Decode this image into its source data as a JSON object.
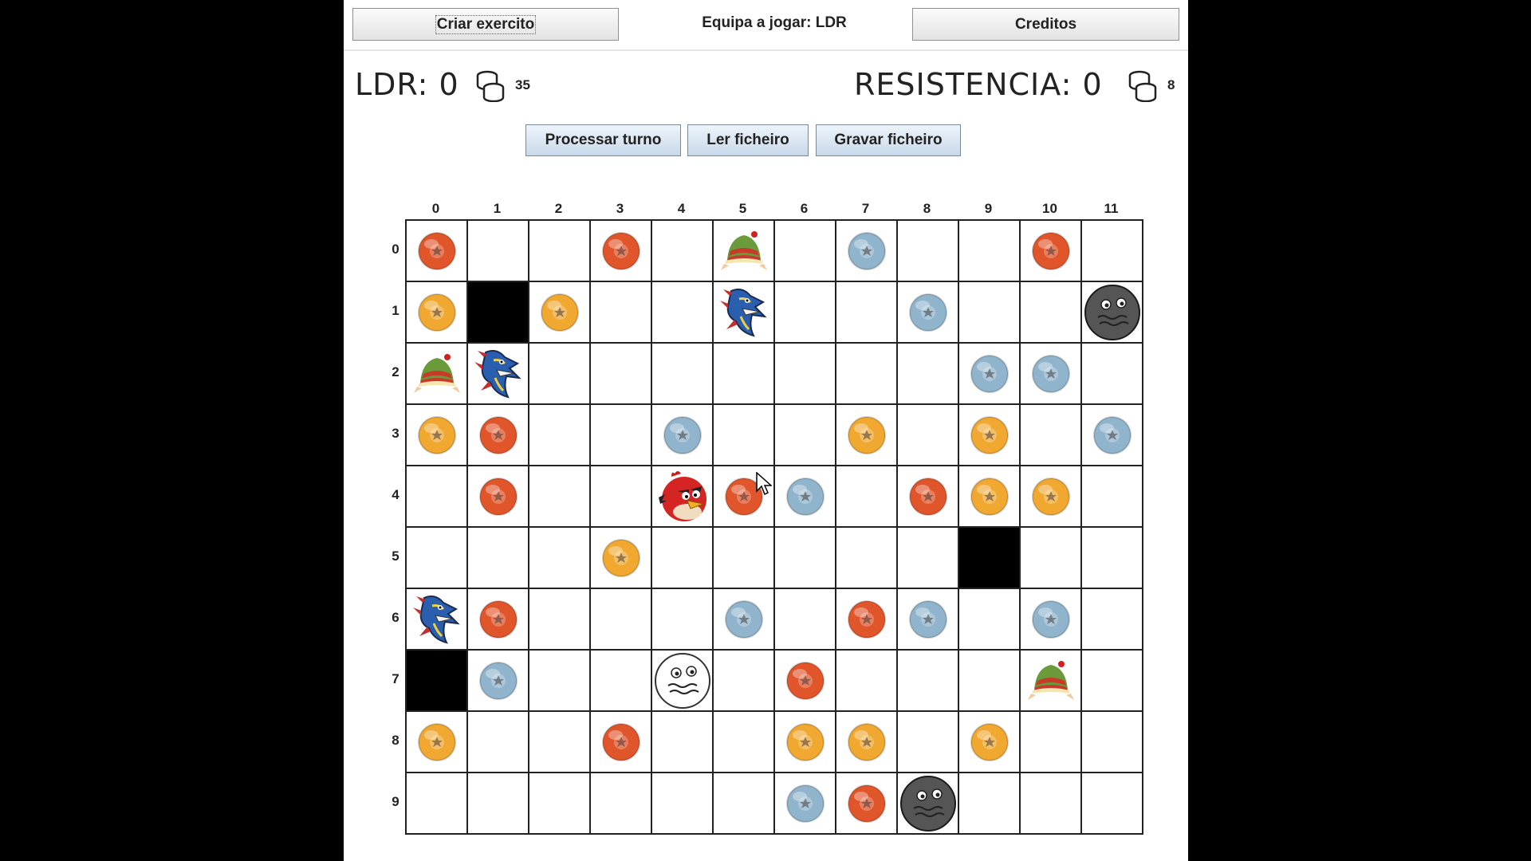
{
  "toolbar": {
    "create_army_label": "Criar exercito",
    "team_playing_label": "Equipa a jogar:  LDR",
    "credits_label": "Creditos"
  },
  "scores": {
    "left_text": "LDR: 0",
    "left_coins": "35",
    "right_text": "RESISTENCIA: 0",
    "right_coins": "8"
  },
  "actions": {
    "process_turn_label": "Processar turno",
    "read_file_label": "Ler ficheiro",
    "save_file_label": "Gravar ficheiro"
  },
  "board": {
    "columns": [
      "0",
      "1",
      "2",
      "3",
      "4",
      "5",
      "6",
      "7",
      "8",
      "9",
      "10",
      "11"
    ],
    "rows": [
      "0",
      "1",
      "2",
      "3",
      "4",
      "5",
      "6",
      "7",
      "8",
      "9"
    ],
    "colors": {
      "orange_coin": "#e0552a",
      "gold_coin": "#f0a830",
      "blue_coin": "#8fb4cc",
      "wall": "#000000"
    },
    "cells": [
      [
        "orange",
        "",
        "",
        "orange",
        "",
        "elf",
        "",
        "blue",
        "",
        "",
        "orange",
        ""
      ],
      [
        "gold",
        "wall",
        "gold",
        "",
        "",
        "dragon",
        "",
        "",
        "blue",
        "",
        "",
        "dark-ghost"
      ],
      [
        "elf",
        "dragon",
        "",
        "",
        "",
        "",
        "",
        "",
        "",
        "blue",
        "blue",
        ""
      ],
      [
        "gold",
        "orange",
        "",
        "",
        "blue",
        "",
        "",
        "gold",
        "",
        "gold",
        "",
        "blue"
      ],
      [
        "",
        "orange",
        "",
        "",
        "bird",
        "orange",
        "blue",
        "",
        "orange",
        "gold",
        "gold",
        ""
      ],
      [
        "",
        "",
        "",
        "gold",
        "",
        "",
        "",
        "",
        "",
        "wall",
        "",
        ""
      ],
      [
        "dragon",
        "orange",
        "",
        "",
        "",
        "blue",
        "",
        "orange",
        "blue",
        "",
        "blue",
        ""
      ],
      [
        "wall",
        "blue",
        "",
        "",
        "white-ghost",
        "",
        "orange",
        "",
        "",
        "",
        "elf",
        ""
      ],
      [
        "gold",
        "",
        "",
        "orange",
        "",
        "",
        "gold",
        "gold",
        "",
        "gold",
        "",
        ""
      ],
      [
        "",
        "",
        "",
        "",
        "",
        "",
        "blue",
        "orange",
        "dark-ghost",
        "",
        "",
        ""
      ]
    ]
  }
}
